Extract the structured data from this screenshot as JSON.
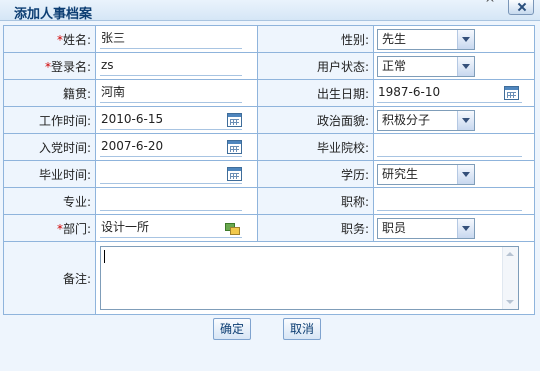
{
  "dialog": {
    "title": "添加人事档案",
    "extra_mark": "^"
  },
  "form": {
    "required_mark": "*",
    "name": {
      "label": "姓名:",
      "value": "张三"
    },
    "gender": {
      "label": "性别:",
      "value": "先生"
    },
    "login": {
      "label": "登录名:",
      "value": "zs"
    },
    "user_status": {
      "label": "用户状态:",
      "value": "正常"
    },
    "origin": {
      "label": "籍贯:",
      "value": "河南"
    },
    "birth_date": {
      "label": "出生日期:",
      "value": "1987-6-10"
    },
    "work_date": {
      "label": "工作时间:",
      "value": "2010-6-15"
    },
    "politics": {
      "label": "政治面貌:",
      "value": "积极分子"
    },
    "party_date": {
      "label": "入党时间:",
      "value": "2007-6-20"
    },
    "school": {
      "label": "毕业院校:",
      "value": ""
    },
    "grad_date": {
      "label": "毕业时间:",
      "value": ""
    },
    "education": {
      "label": "学历:",
      "value": "研究生"
    },
    "major": {
      "label": "专业:",
      "value": ""
    },
    "title": {
      "label": "职称:",
      "value": ""
    },
    "department": {
      "label": "部门:",
      "value": "设计一所"
    },
    "position": {
      "label": "职务:",
      "value": "职员"
    },
    "remark": {
      "label": "备注:",
      "value": ""
    }
  },
  "buttons": {
    "ok": "确定",
    "cancel": "取消"
  },
  "icons": {
    "calendar": "calendar-icon",
    "department_picker": "org-picker-icon",
    "dropdown": "chevron-down-icon",
    "close": "close-icon"
  }
}
